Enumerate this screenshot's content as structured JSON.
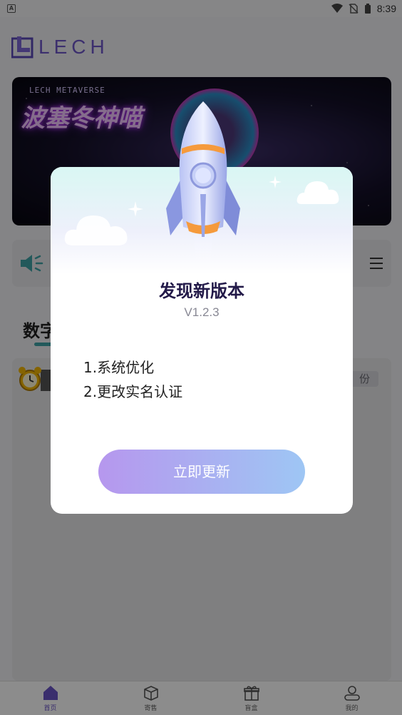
{
  "status_bar": {
    "left_glyph": "A",
    "time": "8:39"
  },
  "header": {
    "logo_text": "LECH"
  },
  "banner": {
    "subtitle": "LECH METAVERSE",
    "title": "波塞冬神喵"
  },
  "section": {
    "title": "数字",
    "share_label": "份"
  },
  "dialog": {
    "title": "发现新版本",
    "version": "V1.2.3",
    "notes": [
      "1.系统优化",
      "2.更改实名认证"
    ],
    "button_label": "立即更新"
  },
  "bottom_nav": {
    "items": [
      {
        "label": "首页",
        "icon": "home-icon",
        "active": true
      },
      {
        "label": "寄售",
        "icon": "box-icon",
        "active": false
      },
      {
        "label": "盲盒",
        "icon": "gift-icon",
        "active": false
      },
      {
        "label": "我的",
        "icon": "user-icon",
        "active": false
      }
    ]
  },
  "colors": {
    "brand": "#6d57c9",
    "button_start": "#b697ee",
    "button_end": "#9ec6f4",
    "accent_teal": "#3ea2a6"
  }
}
